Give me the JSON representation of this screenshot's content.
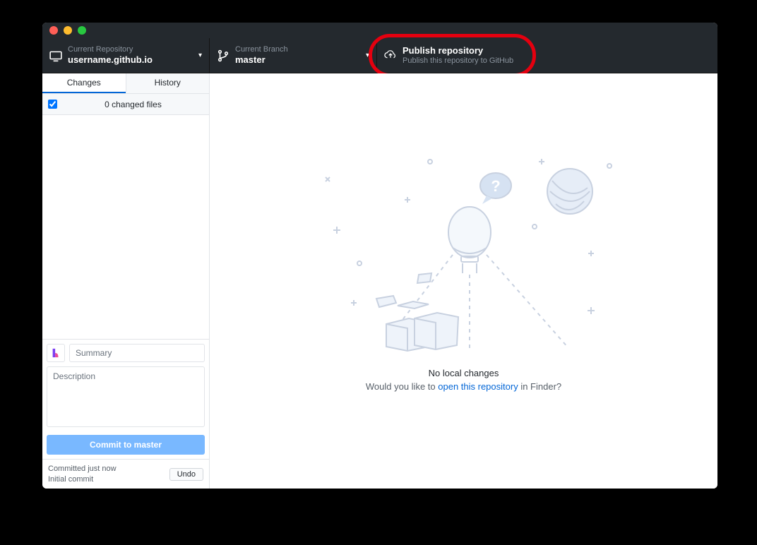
{
  "toolbar": {
    "repo": {
      "label": "Current Repository",
      "value": "username.github.io"
    },
    "branch": {
      "label": "Current Branch",
      "value": "master"
    },
    "publish": {
      "label": "Publish repository",
      "sub": "Publish this repository to GitHub"
    }
  },
  "tabs": {
    "changes": "Changes",
    "history": "History"
  },
  "changes": {
    "count_text": "0 changed files"
  },
  "commit": {
    "summary_placeholder": "Summary",
    "description_placeholder": "Description",
    "button_prefix": "Commit to ",
    "button_branch": "master"
  },
  "footer": {
    "line1": "Committed just now",
    "line2": "Initial commit",
    "undo": "Undo"
  },
  "empty": {
    "headline": "No local changes",
    "prompt_before": "Would you like to ",
    "link": "open this repository",
    "prompt_after": " in Finder?"
  }
}
